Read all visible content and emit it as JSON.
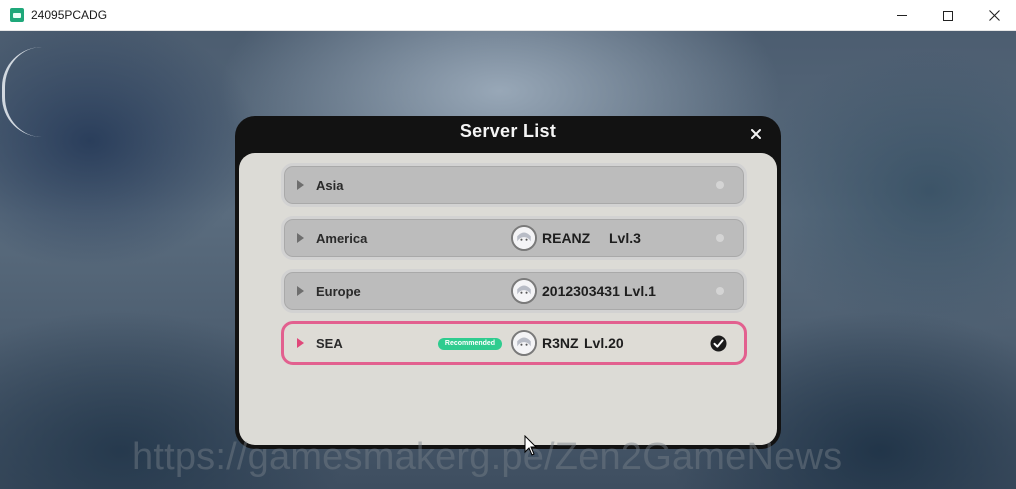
{
  "window": {
    "title": "24095PCADG",
    "icons": {
      "app": "app-icon",
      "minimize": "minimize-icon",
      "maximize": "maximize-icon",
      "close": "close-icon"
    }
  },
  "dialog": {
    "title": "Server List",
    "close_icon": "close-icon"
  },
  "servers": [
    {
      "region": "Asia",
      "badge": "",
      "character": "",
      "level": "",
      "selected": false
    },
    {
      "region": "America",
      "badge": "",
      "character": "REANZ",
      "level": "Lvl.3",
      "selected": false
    },
    {
      "region": "Europe",
      "badge": "",
      "character": "2012303431",
      "level": "Lvl.1",
      "selected": false
    },
    {
      "region": "SEA",
      "badge": "Recommended",
      "character": "R3NZ",
      "level": "Lvl.20",
      "selected": true
    }
  ],
  "watermark": "https://gamesmakerg.pe/Zen2GameNews",
  "colors": {
    "accent_selected": "#e2608f",
    "badge_green": "#2fcc8f",
    "dialog_header": "#121212",
    "dialog_body": "#dcdbd6"
  }
}
